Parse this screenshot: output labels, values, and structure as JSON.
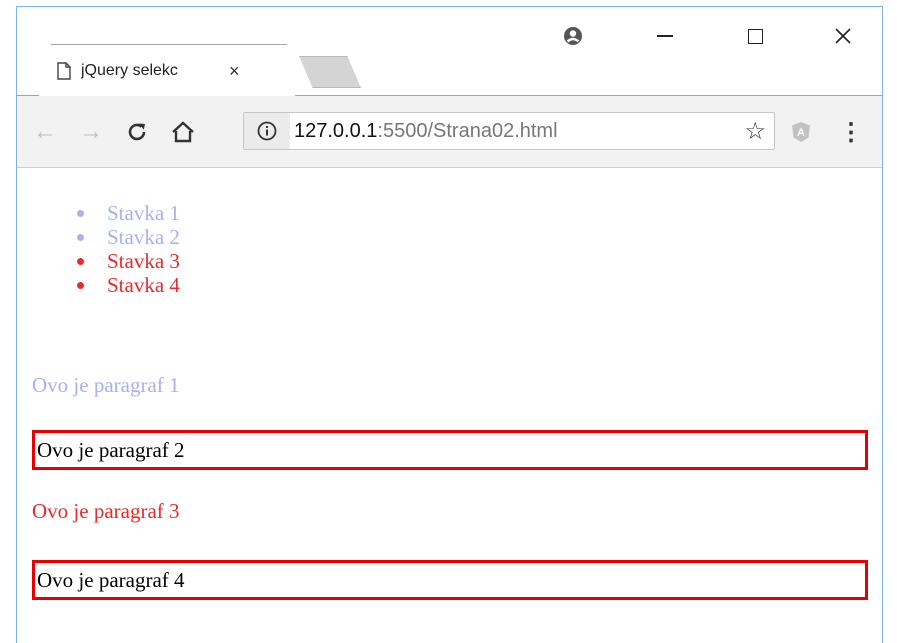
{
  "tab": {
    "title": "jQuery selekc",
    "close": "×"
  },
  "window": {
    "profile": "⚫",
    "minimize": "—",
    "maximize": "☐",
    "close": "✕"
  },
  "toolbar": {
    "back": "←",
    "forward": "→",
    "reload": "C",
    "home": "⌂",
    "url_host": "127.0.0.1",
    "url_rest": ":5500/Strana02.html",
    "star": "☆",
    "extension": "A",
    "menu": "⋮"
  },
  "page": {
    "list_items": [
      {
        "label": "Stavka 1",
        "color": "#a7b1f0"
      },
      {
        "label": "Stavka 2",
        "color": "#a7b1f0"
      },
      {
        "label": "Stavka 3",
        "color": "#e52b2b"
      },
      {
        "label": "Stavka 4",
        "color": "#e52b2b"
      }
    ],
    "paragraphs": [
      {
        "text": "Ovo je paragraf 1",
        "color": "#a7b1f0",
        "boxed": false
      },
      {
        "text": "Ovo je paragraf 2",
        "color": "#000000",
        "boxed": true
      },
      {
        "text": "Ovo je paragraf 3",
        "color": "#e52b2b",
        "boxed": false
      },
      {
        "text": "Ovo je paragraf 4",
        "color": "#000000",
        "boxed": true
      }
    ]
  },
  "colors": {
    "box_border": "#e60000",
    "window_border": "#7fb4e6"
  }
}
